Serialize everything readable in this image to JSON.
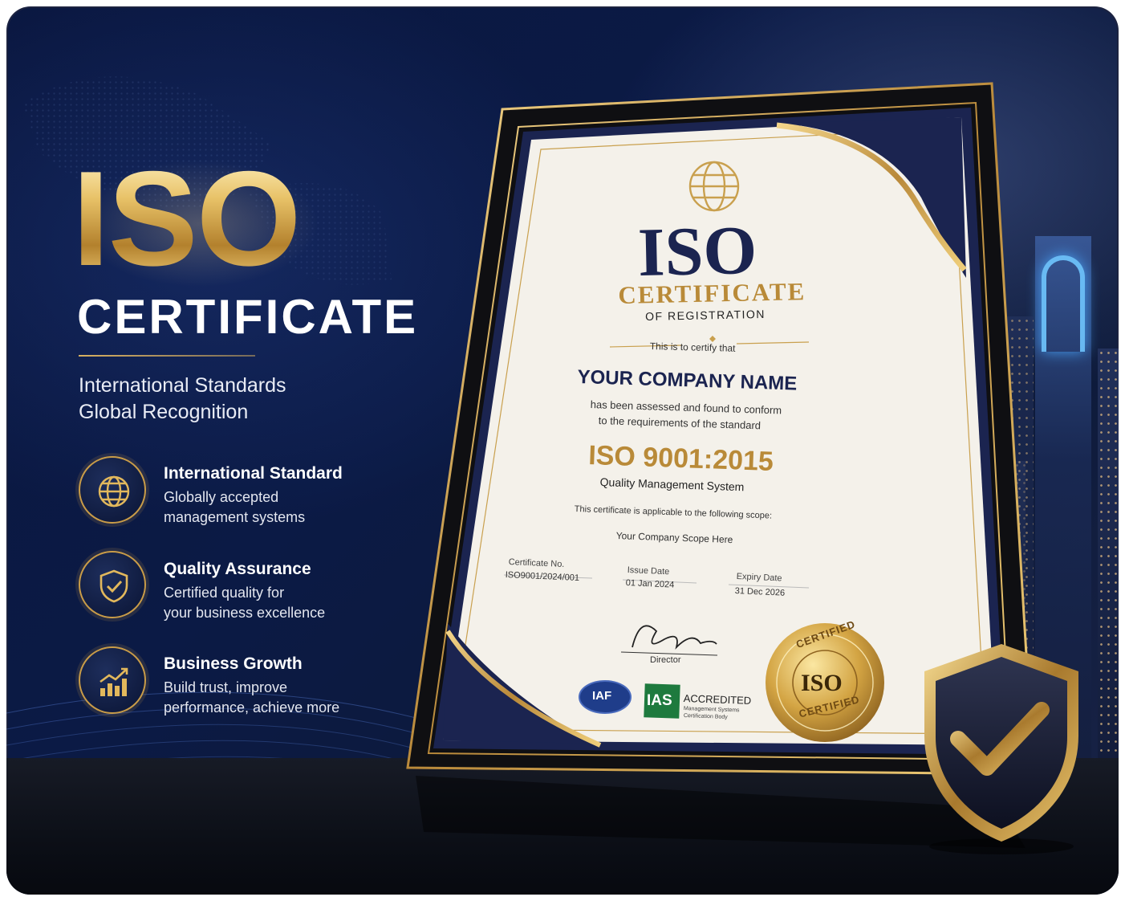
{
  "left": {
    "iso": "ISO",
    "certificate": "CERTIFICATE",
    "subtitle_1": "International Standards",
    "subtitle_2": "Global Recognition",
    "features": [
      {
        "icon": "globe-icon",
        "title": "International Standard",
        "desc_1": "Globally accepted",
        "desc_2": "management systems"
      },
      {
        "icon": "shield-check-icon",
        "title": "Quality Assurance",
        "desc_1": "Certified quality for",
        "desc_2": "your business excellence"
      },
      {
        "icon": "growth-chart-icon",
        "title": "Business Growth",
        "desc_1": "Build trust, improve",
        "desc_2": "performance, achieve more"
      }
    ]
  },
  "certificate": {
    "iso": "ISO",
    "certificate": "CERTIFICATE",
    "of_registration": "OF REGISTRATION",
    "certify_line": "This is to certify that",
    "company": "YOUR COMPANY NAME",
    "conform_1": "has been assessed and found to conform",
    "conform_2": "to the requirements of the standard",
    "standard": "ISO 9001:2015",
    "system": "Quality Management System",
    "scope_intro": "This certificate is applicable to the following scope:",
    "scope": "Your Company Scope Here",
    "cert_no_label": "Certificate No.",
    "cert_no": "ISO9001/2024/001",
    "issue_label": "Issue Date",
    "issue": "01 Jan 2024",
    "expiry_label": "Expiry Date",
    "expiry": "31 Dec 2026",
    "director": "Director",
    "iaf": "IAF",
    "ias": "IAS",
    "accredited": "ACCREDITED",
    "ias_sub_1": "Management Systems",
    "ias_sub_2": "Certification Body",
    "seal_top": "CERTIFIED",
    "seal_center": "ISO",
    "seal_bottom": "CERTIFIED"
  },
  "colors": {
    "navy": "#1b2450",
    "gold": "#c9a04e",
    "paper": "#f4f1ea"
  }
}
